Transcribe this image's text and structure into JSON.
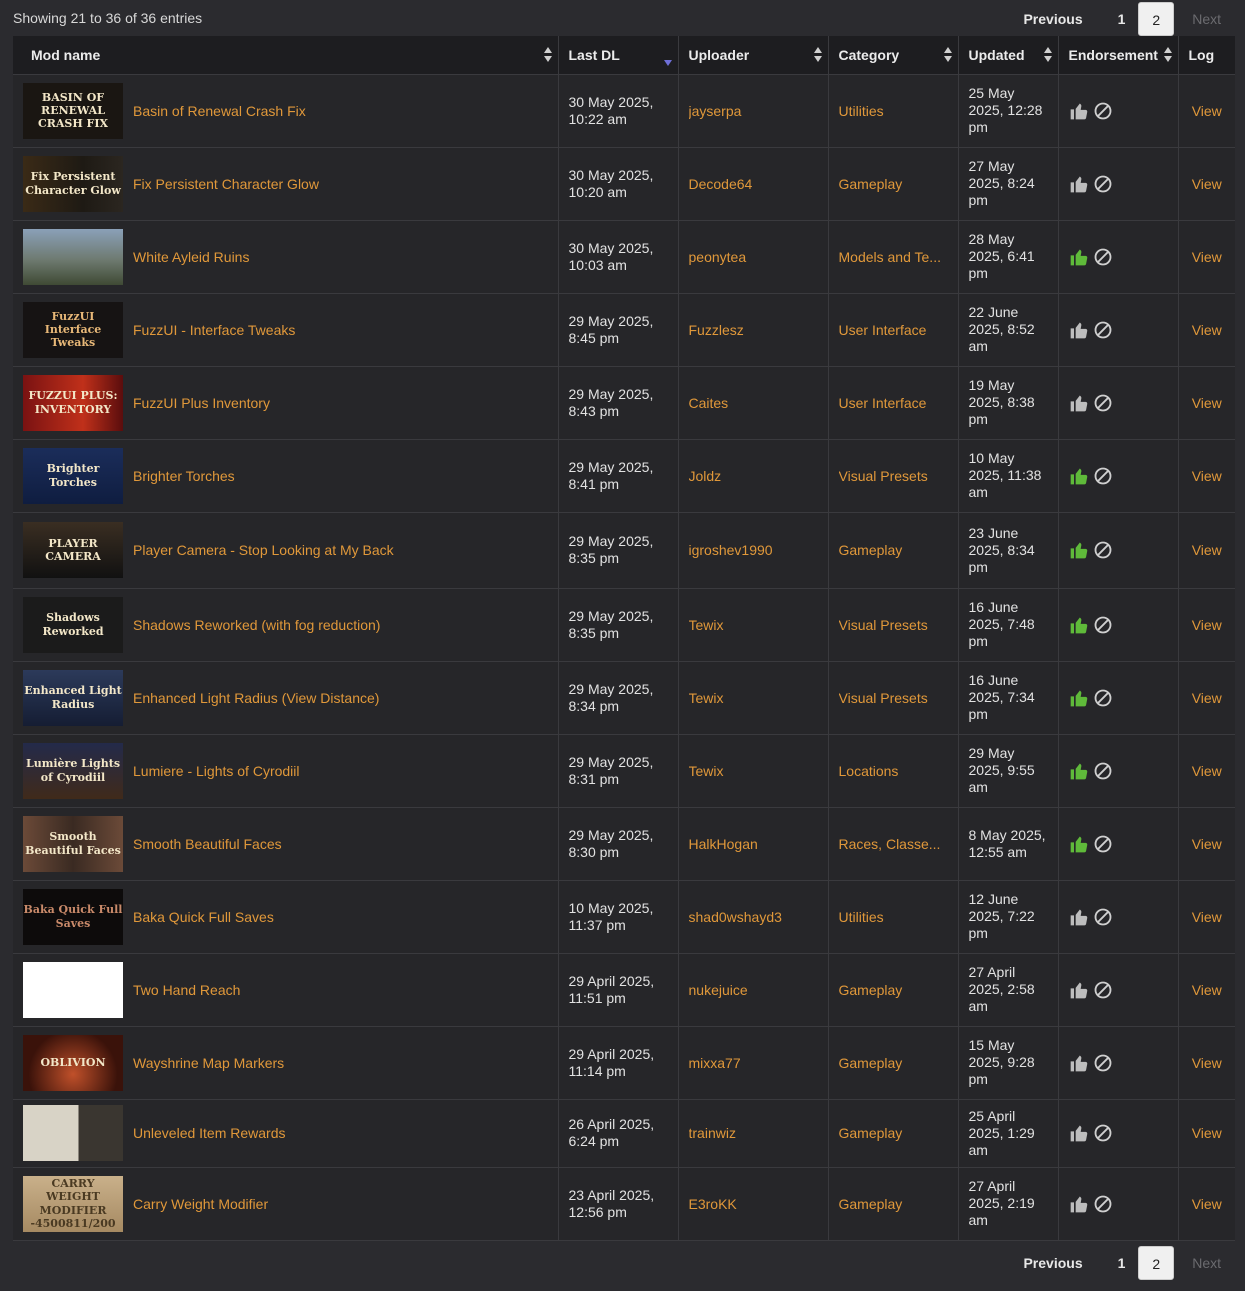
{
  "info": {
    "showing": "Showing 21 to 36 of 36 entries"
  },
  "pagination": {
    "previous": "Previous",
    "page1": "1",
    "page2": "2",
    "next": "Next"
  },
  "columns": {
    "mod_name": "Mod name",
    "last_dl": "Last DL",
    "uploader": "Uploader",
    "category": "Category",
    "updated": "Updated",
    "endorsement": "Endorsement",
    "log": "Log"
  },
  "colors": {
    "link": "#e0983a",
    "endorsed": "#5fba3a",
    "not_endorsed": "#bdbdbd",
    "sort_active": "#6f6fd8"
  },
  "rows": [
    {
      "name": "Basin of Renewal Crash Fix",
      "last_dl": "30 May 2025, 10:22 am",
      "uploader": "jayserpa",
      "category": "Utilities",
      "updated": "25 May 2025, 12:28 pm",
      "endorsed": false,
      "log": "View",
      "thumb_text": "BASIN OF RENEWAL CRASH FIX"
    },
    {
      "name": "Fix Persistent Character Glow",
      "last_dl": "30 May 2025, 10:20 am",
      "uploader": "Decode64",
      "category": "Gameplay",
      "updated": "27 May 2025, 8:24 pm",
      "endorsed": false,
      "log": "View",
      "thumb_text": "Fix Persistent Character Glow"
    },
    {
      "name": "White Ayleid Ruins",
      "last_dl": "30 May 2025, 10:03 am",
      "uploader": "peonytea",
      "category": "Models and Te...",
      "updated": "28 May 2025, 6:41 pm",
      "endorsed": true,
      "log": "View",
      "thumb_text": ""
    },
    {
      "name": "FuzzUI - Interface Tweaks",
      "last_dl": "29 May 2025, 8:45 pm",
      "uploader": "Fuzzlesz",
      "category": "User Interface",
      "updated": "22 June 2025, 8:52 am",
      "endorsed": false,
      "log": "View",
      "thumb_text": "FuzzUI Interface Tweaks"
    },
    {
      "name": "FuzzUI Plus Inventory",
      "last_dl": "29 May 2025, 8:43 pm",
      "uploader": "Caites",
      "category": "User Interface",
      "updated": "19 May 2025, 8:38 pm",
      "endorsed": false,
      "log": "View",
      "thumb_text": "FUZZUI PLUS: INVENTORY"
    },
    {
      "name": "Brighter Torches",
      "last_dl": "29 May 2025, 8:41 pm",
      "uploader": "Joldz",
      "category": "Visual Presets",
      "updated": "10 May 2025, 11:38 am",
      "endorsed": true,
      "log": "View",
      "thumb_text": "Brighter Torches"
    },
    {
      "name": "Player Camera - Stop Looking at My Back",
      "last_dl": "29 May 2025, 8:35 pm",
      "uploader": "igroshev1990",
      "category": "Gameplay",
      "updated": "23 June 2025, 8:34 pm",
      "endorsed": true,
      "log": "View",
      "thumb_text": "PLAYER CAMERA"
    },
    {
      "name": "Shadows Reworked (with fog reduction)",
      "last_dl": "29 May 2025, 8:35 pm",
      "uploader": "Tewix",
      "category": "Visual Presets",
      "updated": "16 June 2025, 7:48 pm",
      "endorsed": true,
      "log": "View",
      "thumb_text": "Shadows Reworked"
    },
    {
      "name": "Enhanced Light Radius (View Distance)",
      "last_dl": "29 May 2025, 8:34 pm",
      "uploader": "Tewix",
      "category": "Visual Presets",
      "updated": "16 June 2025, 7:34 pm",
      "endorsed": true,
      "log": "View",
      "thumb_text": "Enhanced Light Radius"
    },
    {
      "name": "Lumiere - Lights of Cyrodiil",
      "last_dl": "29 May 2025, 8:31 pm",
      "uploader": "Tewix",
      "category": "Locations",
      "updated": "29 May 2025, 9:55 am",
      "endorsed": true,
      "log": "View",
      "thumb_text": "Lumière Lights of Cyrodiil"
    },
    {
      "name": "Smooth Beautiful Faces",
      "last_dl": "29 May 2025, 8:30 pm",
      "uploader": "HalkHogan",
      "category": "Races, Classe...",
      "updated": "8 May 2025, 12:55 am",
      "endorsed": true,
      "log": "View",
      "thumb_text": "Smooth Beautiful Faces"
    },
    {
      "name": "Baka Quick Full Saves",
      "last_dl": "10 May 2025, 11:37 pm",
      "uploader": "shad0wshayd3",
      "category": "Utilities",
      "updated": "12 June 2025, 7:22 pm",
      "endorsed": false,
      "log": "View",
      "thumb_text": "Baka Quick Full Saves"
    },
    {
      "name": "Two Hand Reach",
      "last_dl": "29 April 2025, 11:51 pm",
      "uploader": "nukejuice",
      "category": "Gameplay",
      "updated": "27 April 2025, 2:58 am",
      "endorsed": false,
      "log": "View",
      "thumb_text": ""
    },
    {
      "name": "Wayshrine Map Markers",
      "last_dl": "29 April 2025, 11:14 pm",
      "uploader": "mixxa77",
      "category": "Gameplay",
      "updated": "15 May 2025, 9:28 pm",
      "endorsed": false,
      "log": "View",
      "thumb_text": "OBLIVION"
    },
    {
      "name": "Unleveled Item Rewards",
      "last_dl": "26 April 2025, 6:24 pm",
      "uploader": "trainwiz",
      "category": "Gameplay",
      "updated": "25 April 2025, 1:29 am",
      "endorsed": false,
      "log": "View",
      "thumb_text": ""
    },
    {
      "name": "Carry Weight Modifier",
      "last_dl": "23 April 2025, 12:56 pm",
      "uploader": "E3roKK",
      "category": "Gameplay",
      "updated": "27 April 2025, 2:19 am",
      "endorsed": false,
      "log": "View",
      "thumb_text": "CARRY WEIGHT MODIFIER -4500811/200"
    }
  ]
}
